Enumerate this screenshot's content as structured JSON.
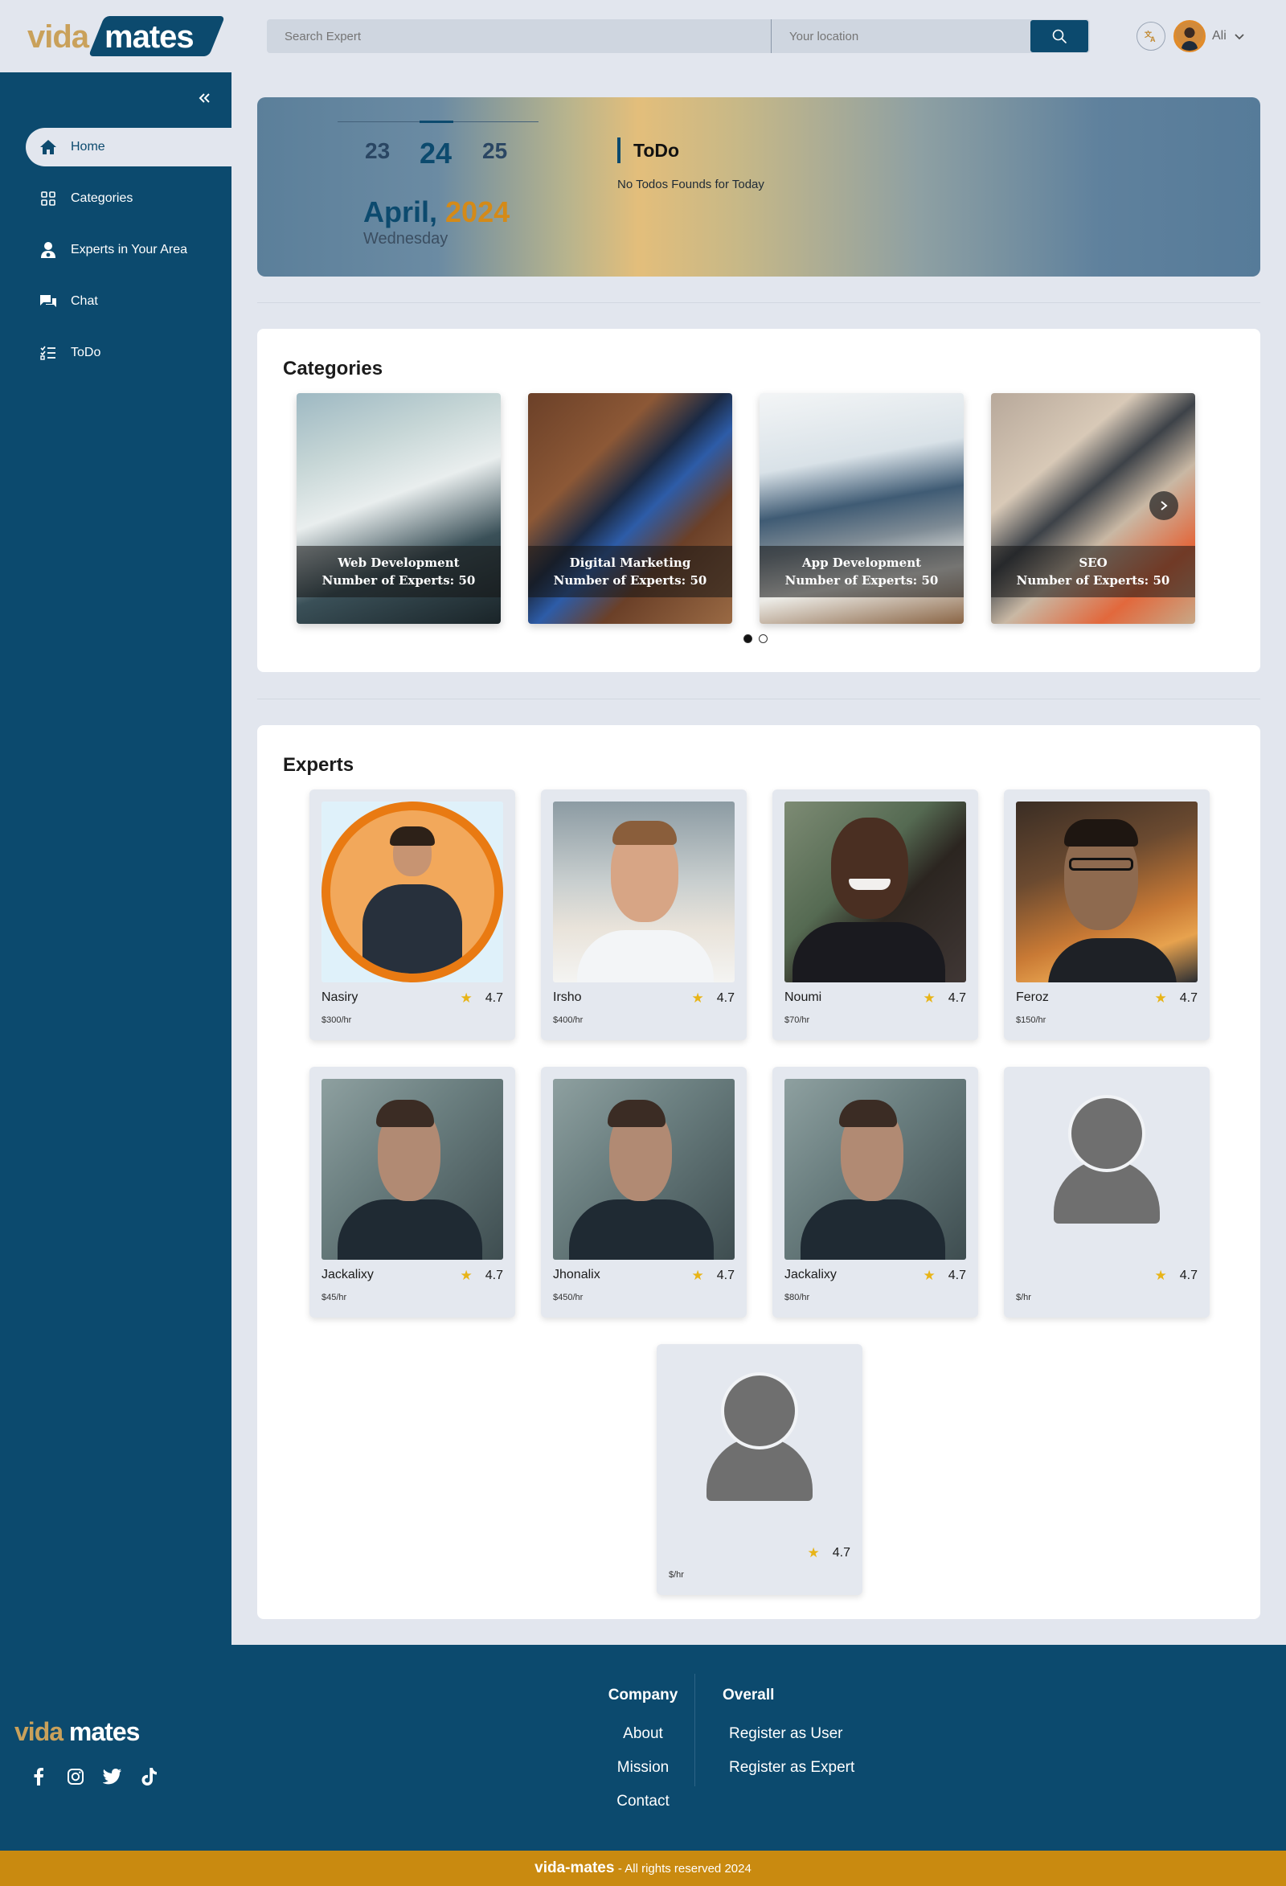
{
  "brand": {
    "vida": "vida",
    "mates": "mates"
  },
  "search": {
    "expert_placeholder": "Search Expert",
    "location_placeholder": "Your location"
  },
  "user": {
    "name": "Ali"
  },
  "sidebar": {
    "items": [
      {
        "label": "Home",
        "icon": "home-icon",
        "active": true
      },
      {
        "label": "Categories",
        "icon": "grid-icon"
      },
      {
        "label": "Experts in Your Area",
        "icon": "user-pin-icon"
      },
      {
        "label": "Chat",
        "icon": "chat-icon"
      },
      {
        "label": "ToDo",
        "icon": "checklist-icon"
      }
    ]
  },
  "hero": {
    "days": [
      "23",
      "24",
      "25"
    ],
    "month": "April,",
    "year": "2024",
    "weekday": "Wednesday",
    "todo_title": "ToDo",
    "todo_empty": "No Todos Founds for Today"
  },
  "categories": {
    "title": "Categories",
    "items": [
      {
        "name": "Web Development",
        "experts": "Number of Experts: 50"
      },
      {
        "name": "Digital Marketing",
        "experts": "Number of Experts: 50"
      },
      {
        "name": "App Development",
        "experts": "Number of Experts: 50"
      },
      {
        "name": "SEO",
        "experts": "Number of Experts: 50"
      }
    ],
    "pages": 2,
    "current_page": 1
  },
  "experts": {
    "title": "Experts",
    "items": [
      {
        "name": "Nasiry",
        "rating": "4.7",
        "price": "$300/hr"
      },
      {
        "name": "Irsho",
        "rating": "4.7",
        "price": "$400/hr"
      },
      {
        "name": "Noumi",
        "rating": "4.7",
        "price": "$70/hr"
      },
      {
        "name": "Feroz",
        "rating": "4.7",
        "price": "$150/hr"
      },
      {
        "name": "Jackalixy",
        "rating": "4.7",
        "price": "$45/hr"
      },
      {
        "name": "Jhonalix",
        "rating": "4.7",
        "price": "$450/hr"
      },
      {
        "name": "Jackalixy",
        "rating": "4.7",
        "price": "$80/hr"
      },
      {
        "name": "",
        "rating": "4.7",
        "price": "$/hr"
      },
      {
        "name": "",
        "rating": "4.7",
        "price": "$/hr"
      }
    ]
  },
  "footer": {
    "company_heading": "Company",
    "company_links": [
      "About",
      "Mission",
      "Contact"
    ],
    "overall_heading": "Overall",
    "overall_links": [
      "Register as User",
      "Register as Expert"
    ],
    "social": [
      "facebook-icon",
      "instagram-icon",
      "twitter-icon",
      "tiktok-icon"
    ],
    "copyright_brand": "vida-mates",
    "copyright_text": "All rights reserved 2024"
  },
  "colors": {
    "primary": "#0c4a6e",
    "accent": "#c98a10",
    "brand_gold": "#c9a15b",
    "star": "#e8b417"
  }
}
